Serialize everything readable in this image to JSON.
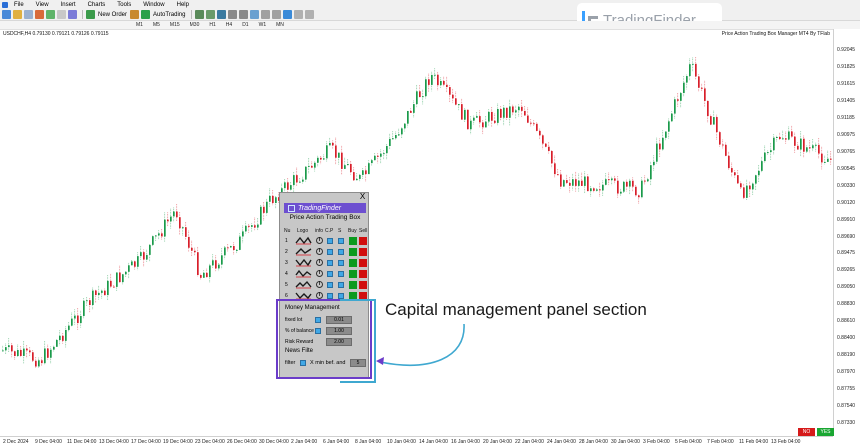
{
  "menu": {
    "items": [
      "File",
      "View",
      "Insert",
      "Charts",
      "Tools",
      "Window",
      "Help"
    ]
  },
  "toolbar": {
    "new_order": "New Order",
    "auto_trading": "AutoTrading"
  },
  "timeframes": [
    "M1",
    "M5",
    "M15",
    "M30",
    "H1",
    "H4",
    "D1",
    "W1",
    "MN"
  ],
  "brand": {
    "name": "TradingFinder"
  },
  "chart": {
    "symbol_info": "USDCHF,H4  0.79130 0.79121 0.79126 0.79115",
    "indicator_name": "Price Action Trading Box Manager MT4 By TFlab",
    "price_labels": [
      "0.92045",
      "0.91825",
      "0.91615",
      "0.91405",
      "0.91185",
      "0.90975",
      "0.90765",
      "0.90545",
      "0.90330",
      "0.90120",
      "0.89910",
      "0.89690",
      "0.89475",
      "0.89265",
      "0.89050",
      "0.88830",
      "0.88610",
      "0.88400",
      "0.88190",
      "0.87970",
      "0.87755",
      "0.87540",
      "0.87330"
    ],
    "time_labels": [
      "2 Dec 2024",
      "9 Dec 04:00",
      "11 Dec 04:00",
      "13 Dec 04:00",
      "17 Dec 04:00",
      "19 Dec 04:00",
      "23 Dec 04:00",
      "26 Dec 04:00",
      "30 Dec 04:00",
      "2 Jan 04:00",
      "6 Jan 04:00",
      "8 Jan 04:00",
      "10 Jan 04:00",
      "14 Jan 04:00",
      "16 Jan 04:00",
      "20 Jan 04:00",
      "22 Jan 04:00",
      "24 Jan 04:00",
      "28 Jan 04:00",
      "30 Jan 04:00",
      "3 Feb 04:00",
      "5 Feb 04:00",
      "7 Feb 04:00",
      "11 Feb 04:00",
      "13 Feb 04:00"
    ]
  },
  "panel": {
    "banner": "TradingFinder",
    "title": "Price Action Trading Box",
    "headers": [
      "Nu",
      "Logo",
      "info",
      "C.P",
      "S",
      "Buy",
      "Sell"
    ],
    "rows": [
      "1",
      "2",
      "3",
      "4",
      "5",
      "6"
    ],
    "info_glyph": "i",
    "close": "X",
    "money_management": {
      "title": "Money Management",
      "fixed_lot_label": "fixed lot",
      "fixed_lot_value": "0.01",
      "balance_label": "% of balance",
      "balance_value": "1.00",
      "risk_reward_label": "Risk Reward",
      "risk_reward_value": "2.00"
    },
    "news_filter": {
      "title": "News Filte",
      "filter_label": "filter",
      "text": "X min bef. and",
      "value": "5"
    }
  },
  "annotation": "Capital management panel section",
  "buttons": {
    "no": "NO",
    "yes": "YES"
  },
  "colors": {
    "bull": "#1a9a4a",
    "bear": "#d81e2a",
    "panel_accent": "#6b3cc9",
    "highlight_cyan": "#3fa8d0"
  }
}
